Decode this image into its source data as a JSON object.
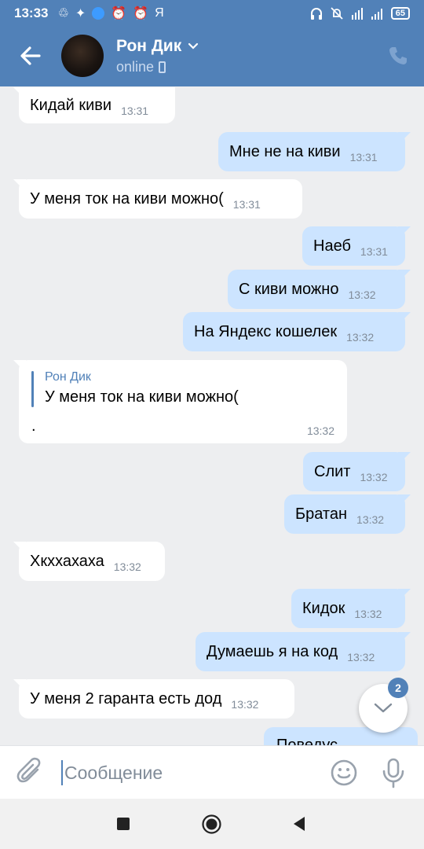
{
  "status_bar": {
    "time": "13:33",
    "icons": [
      "sync-icon",
      "star-icon",
      "globe-icon",
      "alarm-icon",
      "alarm-icon",
      "yandex-icon"
    ],
    "yandex_letter": "Я",
    "right_icons": [
      "headphones-icon",
      "mute-icon",
      "wifi-icon",
      "signal-icon"
    ],
    "battery": "65"
  },
  "header": {
    "contact_name": "Рон Дик",
    "status": "online",
    "accent": "#5181b8"
  },
  "messages": [
    {
      "dir": "in",
      "text": "Кидай киви",
      "time": "13:31"
    },
    {
      "dir": "out",
      "text": "Мне не на киви",
      "time": "13:31"
    },
    {
      "dir": "in",
      "text": "У меня ток на киви можно(",
      "time": "13:31"
    },
    {
      "dir": "out",
      "text": "Наеб",
      "time": "13:31"
    },
    {
      "dir": "out",
      "text": "С киви можно",
      "time": "13:32"
    },
    {
      "dir": "out",
      "text": "На Яндекс кошелек",
      "time": "13:32"
    },
    {
      "dir": "in",
      "reply_to_name": "Рон Дик",
      "reply_to_text": "У меня ток на киви можно(",
      "text": ".",
      "time": "13:32"
    },
    {
      "dir": "out",
      "text": "Слит",
      "time": "13:32"
    },
    {
      "dir": "out",
      "text": "Братан",
      "time": "13:32"
    },
    {
      "dir": "in",
      "text": "Хкххахаха",
      "time": "13:32"
    },
    {
      "dir": "out",
      "text": "Кидок",
      "time": "13:32"
    },
    {
      "dir": "out",
      "text": "Думаешь я на код",
      "time": "13:32"
    },
    {
      "dir": "in",
      "text": "У меня 2 гаранта есть дод",
      "time": "13:32"
    },
    {
      "dir": "out",
      "text": "Поведус",
      "time": ""
    }
  ],
  "scroll_down": {
    "unread_count": "2"
  },
  "composer": {
    "placeholder": "Сообщение"
  },
  "colors": {
    "bubble_out": "#cce4ff",
    "bubble_in": "#ffffff",
    "background": "#edeef0"
  }
}
